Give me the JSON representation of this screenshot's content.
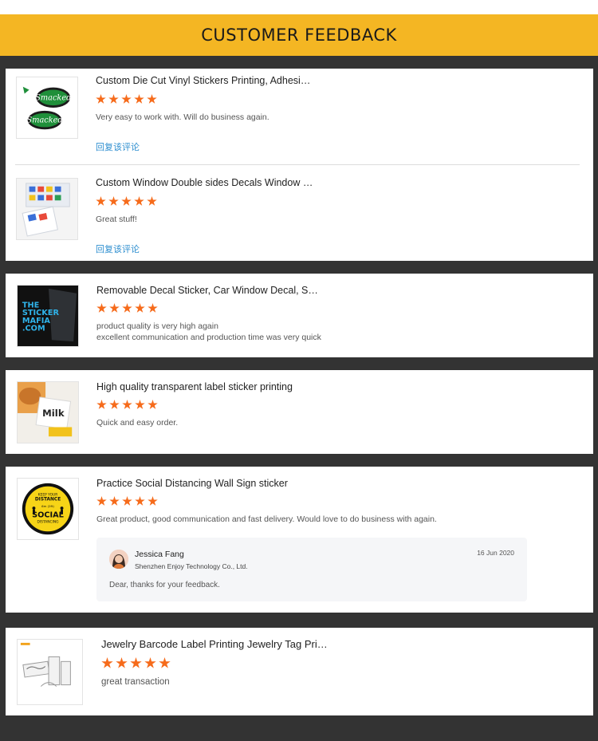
{
  "header": {
    "title": "CUSTOMER FEEDBACK"
  },
  "colors": {
    "banner": "#f4b623",
    "background": "#333333",
    "star": "#f66b1b",
    "link": "#2f8fd0"
  },
  "reviews": [
    {
      "title": "Custom Die Cut Vinyl Stickers Printing, Adhesi…",
      "rating": 5,
      "text": "Very easy to work with.  Will do business again.",
      "reply_link": "回复该评论",
      "thumb_label": "Smacked"
    },
    {
      "title": "Custom Window Double sides Decals Window …",
      "rating": 5,
      "text": "Great stuff!",
      "reply_link": "回复该评论"
    },
    {
      "title": "Removable Decal Sticker, Car Window Decal, S…",
      "rating": 5,
      "text_line1": "product quality is very high again",
      "text_line2": "excellent communication and production time was very quick",
      "thumb_text": [
        "THE",
        "STICKER",
        "MAFIA",
        ".COM"
      ]
    },
    {
      "title": "High quality transparent label sticker printing",
      "rating": 5,
      "text": "Quick and easy order.",
      "thumb_text": "Milk"
    },
    {
      "title": "Practice Social Distancing Wall Sign sticker",
      "rating": 5,
      "text": "Great product, good communication and fast delivery. Would love to do business with again.",
      "thumb_text": {
        "top": "KEEP YOUR",
        "main": "DISTANCE",
        "small": "6m (2ft)",
        "big": "SOCIAL",
        "bottom": "DISTANCING"
      },
      "seller_reply": {
        "name": "Jessica Fang",
        "company": "Shenzhen Enjoy Technology Co., Ltd.",
        "date": "16 Jun 2020",
        "message": "Dear, thanks for your feedback."
      }
    },
    {
      "title": "Jewelry Barcode Label Printing Jewelry Tag Pri…",
      "rating": 5,
      "text": "great transaction"
    }
  ]
}
